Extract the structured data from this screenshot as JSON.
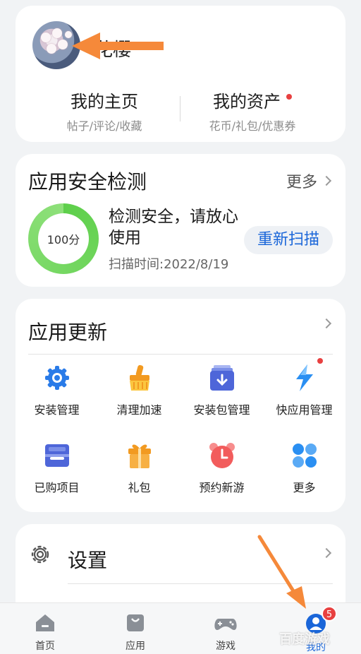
{
  "profile": {
    "username": "花樱",
    "home": {
      "title": "我的主页",
      "subtitle": "帖子/评论/收藏"
    },
    "assets": {
      "title": "我的资产",
      "subtitle": "花币/礼包/优惠券"
    }
  },
  "security": {
    "title": "应用安全检测",
    "more_label": "更多",
    "score": "100分",
    "status": "检测安全，请放心使用",
    "scan_time": "扫描时间:2022/8/19",
    "rescan_label": "重新扫描"
  },
  "updates": {
    "title": "应用更新",
    "items": [
      {
        "label": "安装管理",
        "icon": "install-manage-icon"
      },
      {
        "label": "清理加速",
        "icon": "broom-icon"
      },
      {
        "label": "安装包管理",
        "icon": "package-icon"
      },
      {
        "label": "快应用管理",
        "icon": "lightning-icon"
      },
      {
        "label": "已购项目",
        "icon": "purchased-icon"
      },
      {
        "label": "礼包",
        "icon": "gift-icon"
      },
      {
        "label": "预约新游",
        "icon": "alarm-clock-icon"
      },
      {
        "label": "更多",
        "icon": "four-petal-icon"
      }
    ]
  },
  "settings": {
    "label": "设置"
  },
  "bottom_nav": {
    "items": [
      {
        "label": "首页",
        "icon": "home-icon"
      },
      {
        "label": "应用",
        "icon": "bag-icon"
      },
      {
        "label": "游戏",
        "icon": "gamepad-icon"
      },
      {
        "label": "我的",
        "icon": "user-icon",
        "badge": "5",
        "active": true
      }
    ]
  },
  "watermark": "百度游戏",
  "colors": {
    "accent": "#1a66d9",
    "alert": "#e84040",
    "ring": "#5dcf4a",
    "arrow": "#f5893a"
  }
}
